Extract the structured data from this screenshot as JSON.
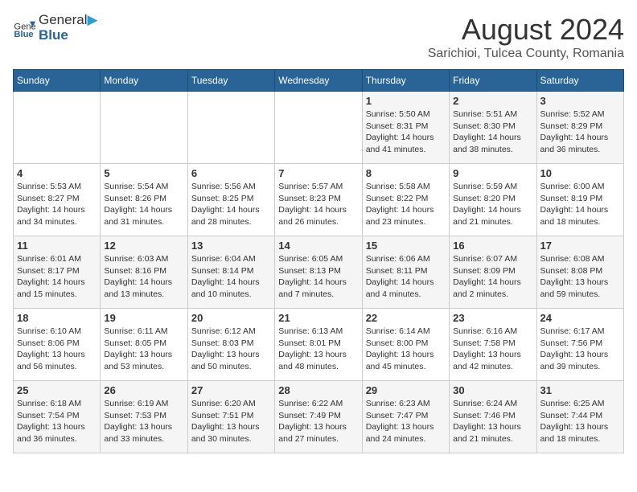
{
  "header": {
    "logo_general": "General",
    "logo_blue": "Blue",
    "month_year": "August 2024",
    "location": "Sarichioi, Tulcea County, Romania"
  },
  "weekdays": [
    "Sunday",
    "Monday",
    "Tuesday",
    "Wednesday",
    "Thursday",
    "Friday",
    "Saturday"
  ],
  "weeks": [
    [
      {
        "day": "",
        "sunrise": "",
        "sunset": "",
        "daylight": ""
      },
      {
        "day": "",
        "sunrise": "",
        "sunset": "",
        "daylight": ""
      },
      {
        "day": "",
        "sunrise": "",
        "sunset": "",
        "daylight": ""
      },
      {
        "day": "",
        "sunrise": "",
        "sunset": "",
        "daylight": ""
      },
      {
        "day": "1",
        "sunrise": "Sunrise: 5:50 AM",
        "sunset": "Sunset: 8:31 PM",
        "daylight": "Daylight: 14 hours and 41 minutes."
      },
      {
        "day": "2",
        "sunrise": "Sunrise: 5:51 AM",
        "sunset": "Sunset: 8:30 PM",
        "daylight": "Daylight: 14 hours and 38 minutes."
      },
      {
        "day": "3",
        "sunrise": "Sunrise: 5:52 AM",
        "sunset": "Sunset: 8:29 PM",
        "daylight": "Daylight: 14 hours and 36 minutes."
      }
    ],
    [
      {
        "day": "4",
        "sunrise": "Sunrise: 5:53 AM",
        "sunset": "Sunset: 8:27 PM",
        "daylight": "Daylight: 14 hours and 34 minutes."
      },
      {
        "day": "5",
        "sunrise": "Sunrise: 5:54 AM",
        "sunset": "Sunset: 8:26 PM",
        "daylight": "Daylight: 14 hours and 31 minutes."
      },
      {
        "day": "6",
        "sunrise": "Sunrise: 5:56 AM",
        "sunset": "Sunset: 8:25 PM",
        "daylight": "Daylight: 14 hours and 28 minutes."
      },
      {
        "day": "7",
        "sunrise": "Sunrise: 5:57 AM",
        "sunset": "Sunset: 8:23 PM",
        "daylight": "Daylight: 14 hours and 26 minutes."
      },
      {
        "day": "8",
        "sunrise": "Sunrise: 5:58 AM",
        "sunset": "Sunset: 8:22 PM",
        "daylight": "Daylight: 14 hours and 23 minutes."
      },
      {
        "day": "9",
        "sunrise": "Sunrise: 5:59 AM",
        "sunset": "Sunset: 8:20 PM",
        "daylight": "Daylight: 14 hours and 21 minutes."
      },
      {
        "day": "10",
        "sunrise": "Sunrise: 6:00 AM",
        "sunset": "Sunset: 8:19 PM",
        "daylight": "Daylight: 14 hours and 18 minutes."
      }
    ],
    [
      {
        "day": "11",
        "sunrise": "Sunrise: 6:01 AM",
        "sunset": "Sunset: 8:17 PM",
        "daylight": "Daylight: 14 hours and 15 minutes."
      },
      {
        "day": "12",
        "sunrise": "Sunrise: 6:03 AM",
        "sunset": "Sunset: 8:16 PM",
        "daylight": "Daylight: 14 hours and 13 minutes."
      },
      {
        "day": "13",
        "sunrise": "Sunrise: 6:04 AM",
        "sunset": "Sunset: 8:14 PM",
        "daylight": "Daylight: 14 hours and 10 minutes."
      },
      {
        "day": "14",
        "sunrise": "Sunrise: 6:05 AM",
        "sunset": "Sunset: 8:13 PM",
        "daylight": "Daylight: 14 hours and 7 minutes."
      },
      {
        "day": "15",
        "sunrise": "Sunrise: 6:06 AM",
        "sunset": "Sunset: 8:11 PM",
        "daylight": "Daylight: 14 hours and 4 minutes."
      },
      {
        "day": "16",
        "sunrise": "Sunrise: 6:07 AM",
        "sunset": "Sunset: 8:09 PM",
        "daylight": "Daylight: 14 hours and 2 minutes."
      },
      {
        "day": "17",
        "sunrise": "Sunrise: 6:08 AM",
        "sunset": "Sunset: 8:08 PM",
        "daylight": "Daylight: 13 hours and 59 minutes."
      }
    ],
    [
      {
        "day": "18",
        "sunrise": "Sunrise: 6:10 AM",
        "sunset": "Sunset: 8:06 PM",
        "daylight": "Daylight: 13 hours and 56 minutes."
      },
      {
        "day": "19",
        "sunrise": "Sunrise: 6:11 AM",
        "sunset": "Sunset: 8:05 PM",
        "daylight": "Daylight: 13 hours and 53 minutes."
      },
      {
        "day": "20",
        "sunrise": "Sunrise: 6:12 AM",
        "sunset": "Sunset: 8:03 PM",
        "daylight": "Daylight: 13 hours and 50 minutes."
      },
      {
        "day": "21",
        "sunrise": "Sunrise: 6:13 AM",
        "sunset": "Sunset: 8:01 PM",
        "daylight": "Daylight: 13 hours and 48 minutes."
      },
      {
        "day": "22",
        "sunrise": "Sunrise: 6:14 AM",
        "sunset": "Sunset: 8:00 PM",
        "daylight": "Daylight: 13 hours and 45 minutes."
      },
      {
        "day": "23",
        "sunrise": "Sunrise: 6:16 AM",
        "sunset": "Sunset: 7:58 PM",
        "daylight": "Daylight: 13 hours and 42 minutes."
      },
      {
        "day": "24",
        "sunrise": "Sunrise: 6:17 AM",
        "sunset": "Sunset: 7:56 PM",
        "daylight": "Daylight: 13 hours and 39 minutes."
      }
    ],
    [
      {
        "day": "25",
        "sunrise": "Sunrise: 6:18 AM",
        "sunset": "Sunset: 7:54 PM",
        "daylight": "Daylight: 13 hours and 36 minutes."
      },
      {
        "day": "26",
        "sunrise": "Sunrise: 6:19 AM",
        "sunset": "Sunset: 7:53 PM",
        "daylight": "Daylight: 13 hours and 33 minutes."
      },
      {
        "day": "27",
        "sunrise": "Sunrise: 6:20 AM",
        "sunset": "Sunset: 7:51 PM",
        "daylight": "Daylight: 13 hours and 30 minutes."
      },
      {
        "day": "28",
        "sunrise": "Sunrise: 6:22 AM",
        "sunset": "Sunset: 7:49 PM",
        "daylight": "Daylight: 13 hours and 27 minutes."
      },
      {
        "day": "29",
        "sunrise": "Sunrise: 6:23 AM",
        "sunset": "Sunset: 7:47 PM",
        "daylight": "Daylight: 13 hours and 24 minutes."
      },
      {
        "day": "30",
        "sunrise": "Sunrise: 6:24 AM",
        "sunset": "Sunset: 7:46 PM",
        "daylight": "Daylight: 13 hours and 21 minutes."
      },
      {
        "day": "31",
        "sunrise": "Sunrise: 6:25 AM",
        "sunset": "Sunset: 7:44 PM",
        "daylight": "Daylight: 13 hours and 18 minutes."
      }
    ]
  ]
}
